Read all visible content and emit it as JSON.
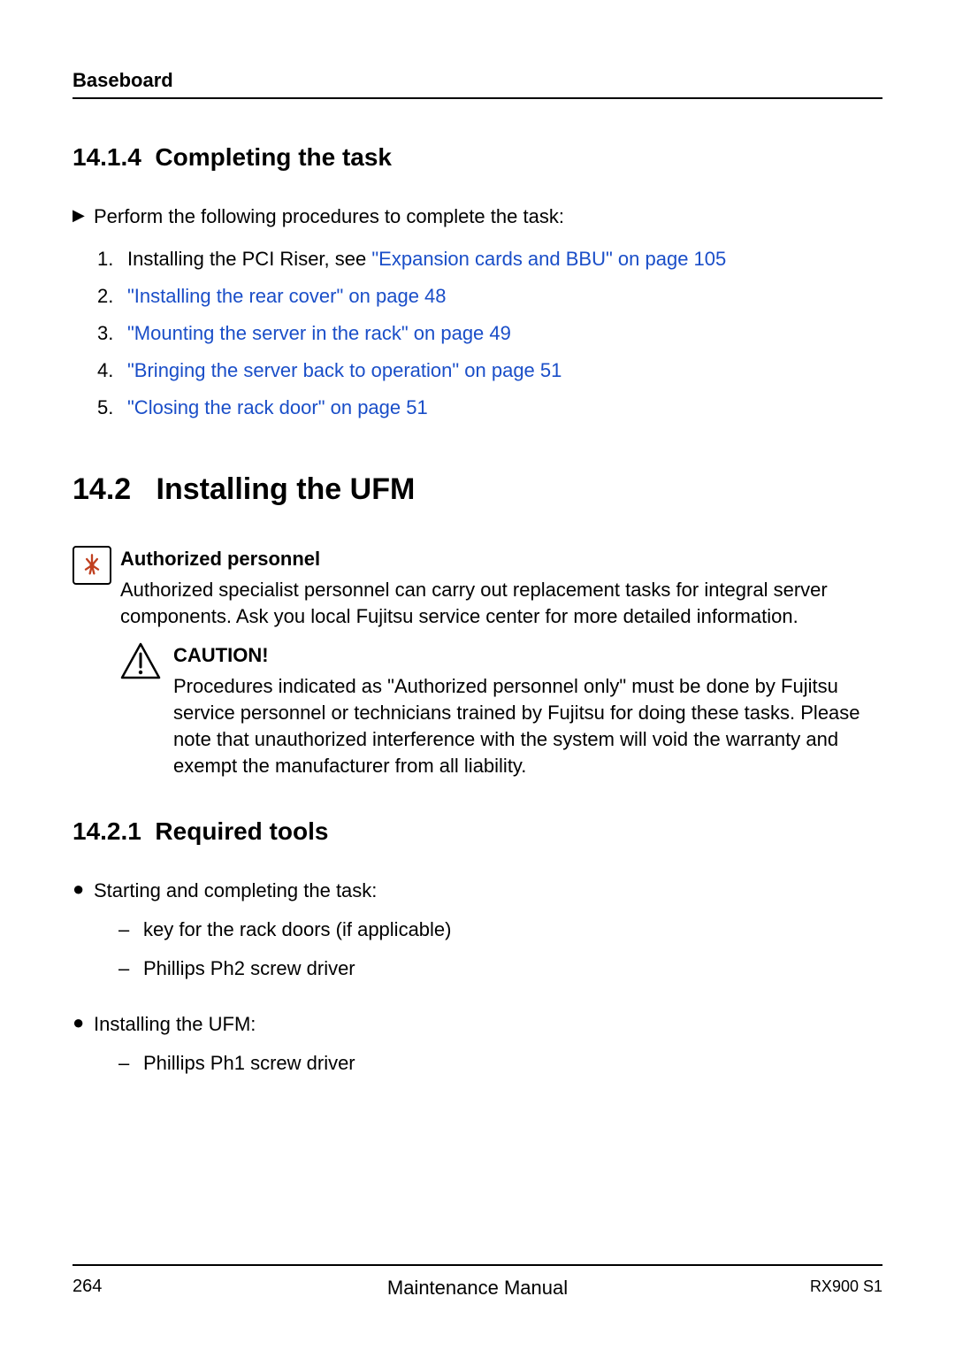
{
  "header": "Baseboard",
  "section1": {
    "number": "14.1.4",
    "title": "Completing the task",
    "intro": "Perform the following procedures to complete the task:",
    "steps": [
      {
        "n": "1.",
        "pre": "Installing the PCI Riser, see ",
        "link": "\"Expansion cards and BBU\" on page 105"
      },
      {
        "n": "2.",
        "pre": "",
        "link": "\"Installing the rear cover\" on page 48"
      },
      {
        "n": "3.",
        "pre": "",
        "link": "\"Mounting the server in the rack\" on page 49"
      },
      {
        "n": "4.",
        "pre": "",
        "link": "\"Bringing the server back to operation\" on page 51"
      },
      {
        "n": "5.",
        "pre": "",
        "link": "\"Closing the rack door\" on page 51"
      }
    ]
  },
  "section2": {
    "number": "14.2",
    "title": "Installing the UFM",
    "auth_title": "Authorized personnel",
    "auth_body": "Authorized specialist personnel can carry out replacement tasks for integral server components. Ask you local Fujitsu service center for more detailed information.",
    "caution_title": "CAUTION!",
    "caution_body": "Procedures indicated as \"Authorized personnel only\" must be done by Fujitsu service personnel or technicians trained by Fujitsu for doing these tasks. Please note that unauthorized interference with the system will void the warranty and exempt the manufacturer from all liability."
  },
  "section3": {
    "number": "14.2.1",
    "title": "Required tools",
    "bullets": [
      {
        "text": "Starting and completing the task:",
        "dashes": [
          "key for the rack doors (if applicable)",
          "Phillips Ph2 screw driver"
        ]
      },
      {
        "text": "Installing the UFM:",
        "dashes": [
          "Phillips Ph1 screw driver"
        ]
      }
    ]
  },
  "footer": {
    "page": "264",
    "center": "Maintenance Manual",
    "right": "RX900 S1"
  }
}
